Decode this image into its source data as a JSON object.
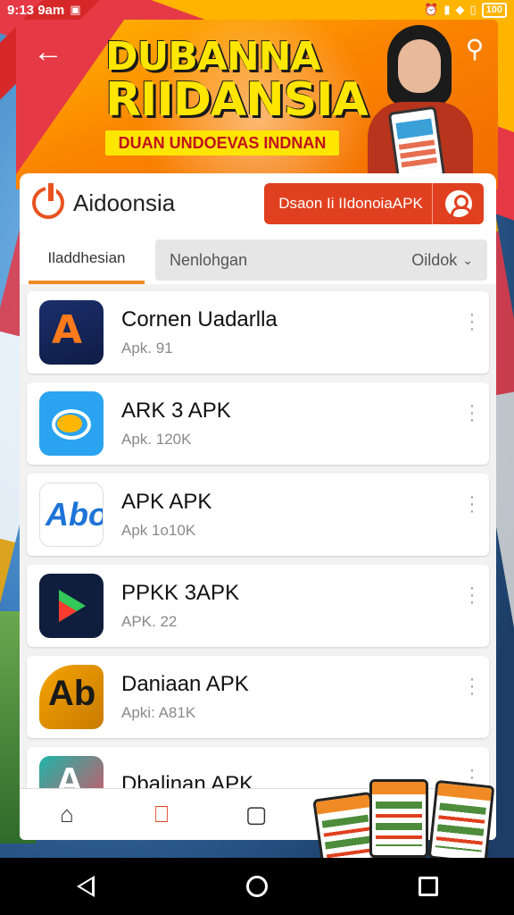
{
  "status_bar": {
    "time": "9:13 9am",
    "battery": "100"
  },
  "banner": {
    "title_line1": "DUBANNA",
    "title_line2": "RIIDANSIA",
    "subtitle": "DUAN UNDOEVAS INDNAN"
  },
  "app_bar": {
    "brand": "Aidoonsia",
    "download_label": "Dsaon Ii IIdonoiaAPK"
  },
  "tabs": {
    "active": "Iladdhesian",
    "secondary": "Nenlohgan",
    "sort_label": "Oildok"
  },
  "apps": [
    {
      "name": "Cornen Uadarlla",
      "meta": "Apk. 91",
      "icon_text": "A"
    },
    {
      "name": "ARK 3 APK",
      "meta": "Apk. 120K",
      "icon_text": ""
    },
    {
      "name": "APK APK",
      "meta": "Apk 1o10K",
      "icon_text": "Abo"
    },
    {
      "name": "PPKK 3APK",
      "meta": "APK. 22",
      "icon_text": ""
    },
    {
      "name": "Daniaan APK",
      "meta": "Apki: A81K",
      "icon_text": "Ab"
    },
    {
      "name": "Dbalinan APK",
      "meta": "",
      "icon_text": "A"
    }
  ],
  "bottom_nav": {
    "home_icon": "home-icon",
    "apps_icon": "book-icon",
    "square_icon": "square-icon"
  },
  "colors": {
    "accent": "#e0401f",
    "tab_underline": "#f08a24",
    "banner_yellow": "#ffe600"
  }
}
